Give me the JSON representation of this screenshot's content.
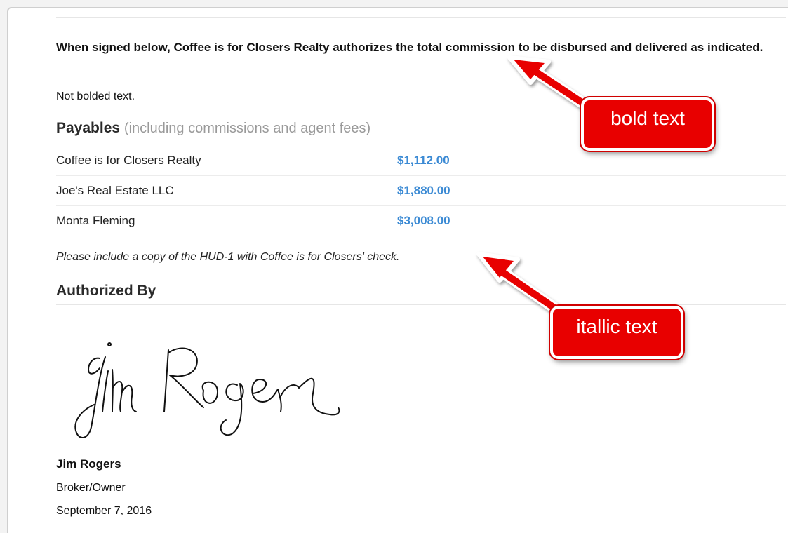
{
  "authorization": {
    "statement": "When signed below, Coffee is for Closers Realty authorizes the total commission to be disbursed and delivered as indicated.",
    "plain_text": "Not bolded text."
  },
  "payables": {
    "heading": "Payables",
    "subheading": "(including commissions and agent fees)",
    "rows": [
      {
        "payee": "Coffee is for Closers Realty",
        "amount": "$1,112.00"
      },
      {
        "payee": "Joe's Real Estate LLC",
        "amount": "$1,880.00"
      },
      {
        "payee": "Monta Fleming",
        "amount": "$3,008.00"
      }
    ],
    "note": "Please include a copy of the HUD-1 with Coffee is for Closers' check.",
    "amount_color": "#3b8ad4"
  },
  "authorized_by": {
    "heading": "Authorized By",
    "signature_text": "Jim Rogers",
    "name": "Jim Rogers",
    "title": "Broker/Owner",
    "date": "September 7, 2016"
  },
  "annotations": {
    "bold_label": "bold text",
    "italic_label": "itallic text",
    "callout_color": "#e80000"
  }
}
